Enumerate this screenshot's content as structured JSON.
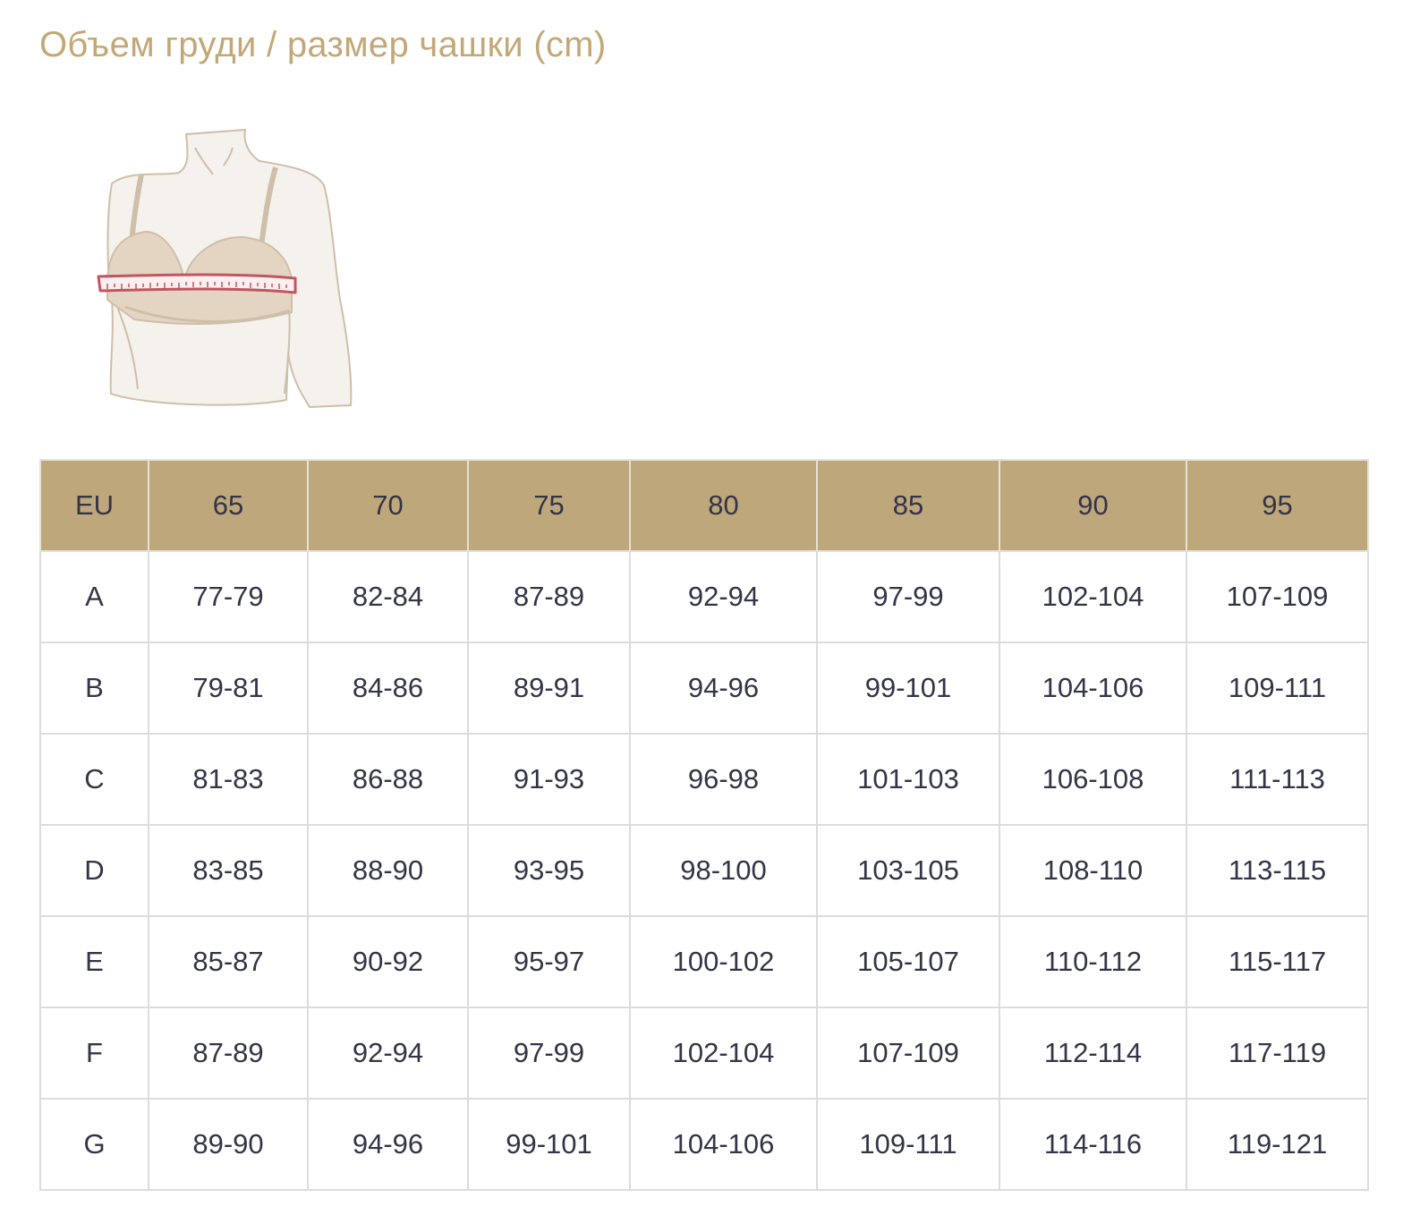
{
  "title": "Объем груди / размер чашки (cm)",
  "illustration": {
    "icon": "bust-measurement-illustration"
  },
  "table": {
    "headers": [
      "EU",
      "65",
      "70",
      "75",
      "80",
      "85",
      "90",
      "95"
    ],
    "rows": [
      [
        "A",
        "77-79",
        "82-84",
        "87-89",
        "92-94",
        "97-99",
        "102-104",
        "107-109"
      ],
      [
        "B",
        "79-81",
        "84-86",
        "89-91",
        "94-96",
        "99-101",
        "104-106",
        "109-111"
      ],
      [
        "C",
        "81-83",
        "86-88",
        "91-93",
        "96-98",
        "101-103",
        "106-108",
        "111-113"
      ],
      [
        "D",
        "83-85",
        "88-90",
        "93-95",
        "98-100",
        "103-105",
        "108-110",
        "113-115"
      ],
      [
        "E",
        "85-87",
        "90-92",
        "95-97",
        "100-102",
        "105-107",
        "110-112",
        "115-117"
      ],
      [
        "F",
        "87-89",
        "92-94",
        "97-99",
        "102-104",
        "107-109",
        "112-114",
        "117-119"
      ],
      [
        "G",
        "89-90",
        "94-96",
        "99-101",
        "104-106",
        "109-111",
        "114-116",
        "119-121"
      ]
    ]
  },
  "colors": {
    "title": "#c2a878",
    "header_bg": "#bfa77c",
    "text": "#343447",
    "border": "#dcdcdc",
    "tape": "#c2555f"
  }
}
